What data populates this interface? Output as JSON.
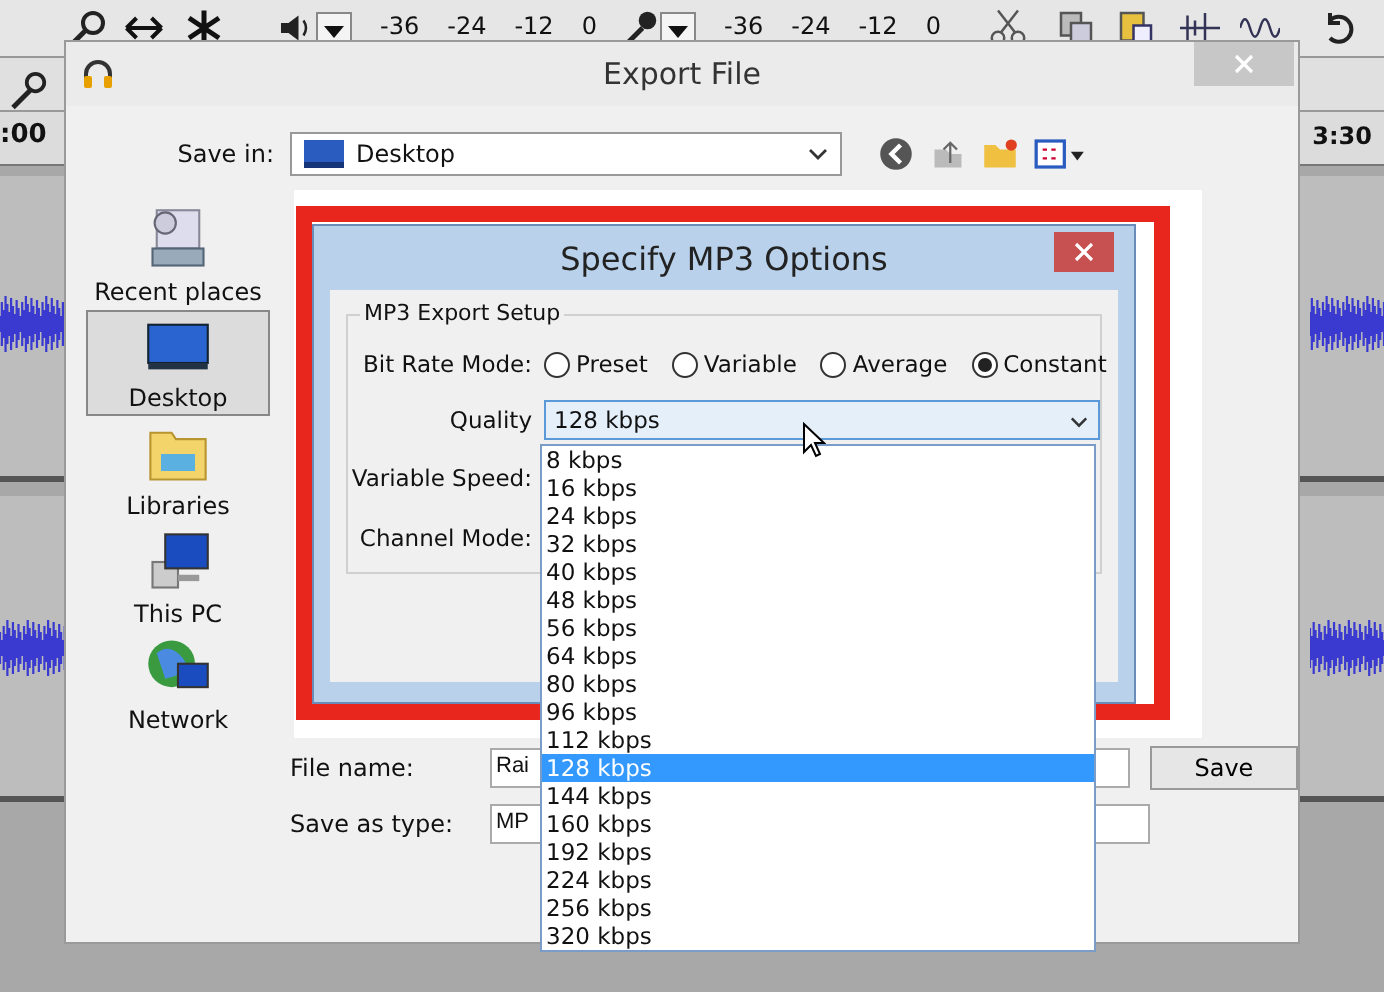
{
  "toolbar": {
    "meter_scales": [
      [
        "-36",
        "-24",
        "-12",
        "0"
      ],
      [
        "-36",
        "-24",
        "-12",
        "0"
      ]
    ]
  },
  "timeline": {
    "labels": [
      ":00",
      "3:30"
    ]
  },
  "export_dialog": {
    "title": "Export File",
    "save_in": {
      "label": "Save in:",
      "value": "Desktop"
    },
    "places": [
      {
        "kind": "recent",
        "label": "Recent places",
        "selected": false
      },
      {
        "kind": "desktop",
        "label": "Desktop",
        "selected": true
      },
      {
        "kind": "libraries",
        "label": "Libraries",
        "selected": false
      },
      {
        "kind": "pc",
        "label": "This PC",
        "selected": false
      },
      {
        "kind": "network",
        "label": "Network",
        "selected": false
      }
    ],
    "file_name": {
      "label": "File name:",
      "value": "Rai"
    },
    "save_as_type": {
      "label": "Save as type:",
      "value": "MP"
    },
    "save_button": "Save"
  },
  "mp3_dialog": {
    "title": "Specify MP3 Options",
    "group": "MP3 Export Setup",
    "bit_rate_label": "Bit Rate Mode:",
    "modes": [
      {
        "label": "Preset",
        "selected": false
      },
      {
        "label": "Variable",
        "selected": false
      },
      {
        "label": "Average",
        "selected": false
      },
      {
        "label": "Constant",
        "selected": true
      }
    ],
    "quality": {
      "label": "Quality",
      "value": "128 kbps",
      "options": [
        {
          "label": "8 kbps",
          "selected": false
        },
        {
          "label": "16 kbps",
          "selected": false
        },
        {
          "label": "24 kbps",
          "selected": false
        },
        {
          "label": "32 kbps",
          "selected": false
        },
        {
          "label": "40 kbps",
          "selected": false
        },
        {
          "label": "48 kbps",
          "selected": false
        },
        {
          "label": "56 kbps",
          "selected": false
        },
        {
          "label": "64 kbps",
          "selected": false
        },
        {
          "label": "80 kbps",
          "selected": false
        },
        {
          "label": "96 kbps",
          "selected": false
        },
        {
          "label": "112 kbps",
          "selected": false
        },
        {
          "label": "128 kbps",
          "selected": true
        },
        {
          "label": "144 kbps",
          "selected": false
        },
        {
          "label": "160 kbps",
          "selected": false
        },
        {
          "label": "192 kbps",
          "selected": false
        },
        {
          "label": "224 kbps",
          "selected": false
        },
        {
          "label": "256 kbps",
          "selected": false
        },
        {
          "label": "320 kbps",
          "selected": false
        }
      ]
    },
    "variable_speed_label": "Variable Speed:",
    "channel_mode_label": "Channel Mode:"
  }
}
